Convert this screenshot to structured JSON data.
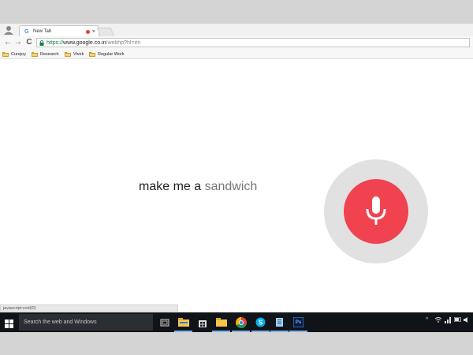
{
  "browser": {
    "tab": {
      "title": "New Tab",
      "favicon": "G",
      "close": "×"
    },
    "address": {
      "secure": "https://",
      "host": "www.google.co.in",
      "path": "/webhp?hl=en"
    },
    "nav": {
      "back": "←",
      "forward": "→",
      "reload": "C"
    },
    "bookmarks": [
      {
        "label": "Curejoy"
      },
      {
        "label": "Research"
      },
      {
        "label": "Vivek"
      },
      {
        "label": "Regular Work"
      }
    ],
    "status_text": "javascript:void(0)"
  },
  "voice": {
    "query_spoken": "make me a ",
    "query_pending": "sandwich",
    "mic_color": "#f0434f",
    "ring_color": "#e1e1e1"
  },
  "taskbar": {
    "search_placeholder": "Search the web and Windows",
    "apps": [
      "task-view-icon",
      "file-explorer-icon",
      "store-icon",
      "folder-icon",
      "chrome-icon",
      "skype-icon",
      "notepad-icon",
      "photoshop-icon"
    ],
    "photoshop_label": "Ps",
    "tray": {
      "chevron": "^"
    }
  }
}
